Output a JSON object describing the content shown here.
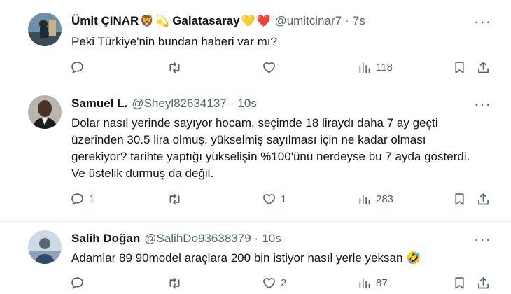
{
  "tweets": [
    {
      "name": "Ümit ÇINAR",
      "name_emojis": [
        "🦁",
        "💫",
        "Galatasaray",
        "💛",
        "❤️"
      ],
      "handle": "@umitcinar7",
      "dot": "·",
      "time": "7s",
      "text": "Peki Türkiye'nin bundan haberi var mı?",
      "replies": "",
      "retweets": "",
      "likes": "",
      "views": "118"
    },
    {
      "name": "Samuel L.",
      "handle": "@Sheyl82634137",
      "dot": "·",
      "time": "10s",
      "text_lines": [
        "Dolar nasıl yerinde sayıyor hocam, seçimde 18 liraydı daha 7 ay geçti",
        "üzerinden 30.5 lira olmuş. yükselmiş sayılması için ne kadar olması",
        "gerekiyor? tarihte yaptığı yükselişin %100'ünü nerdeyse bu 7 ayda gösterdi.",
        "Ve üstelik durmuş da değil."
      ],
      "replies": "1",
      "retweets": "",
      "likes": "1",
      "views": "283"
    },
    {
      "name": "Salih Doğan",
      "handle": "@SalihDo93638379",
      "dot": "·",
      "time": "10s",
      "text": "Adamlar 89 90model araçlara 200 bin istiyor nasıl yerle yeksan 🤣",
      "replies": "",
      "retweets": "",
      "likes": "2",
      "views": "87"
    }
  ],
  "more_label": "···",
  "colors": {
    "secondary": "#536471",
    "text": "#0f1419",
    "divider": "#eff3f4"
  },
  "icons": [
    "reply-icon",
    "retweet-icon",
    "like-icon",
    "views-icon",
    "bookmark-icon",
    "share-icon"
  ]
}
